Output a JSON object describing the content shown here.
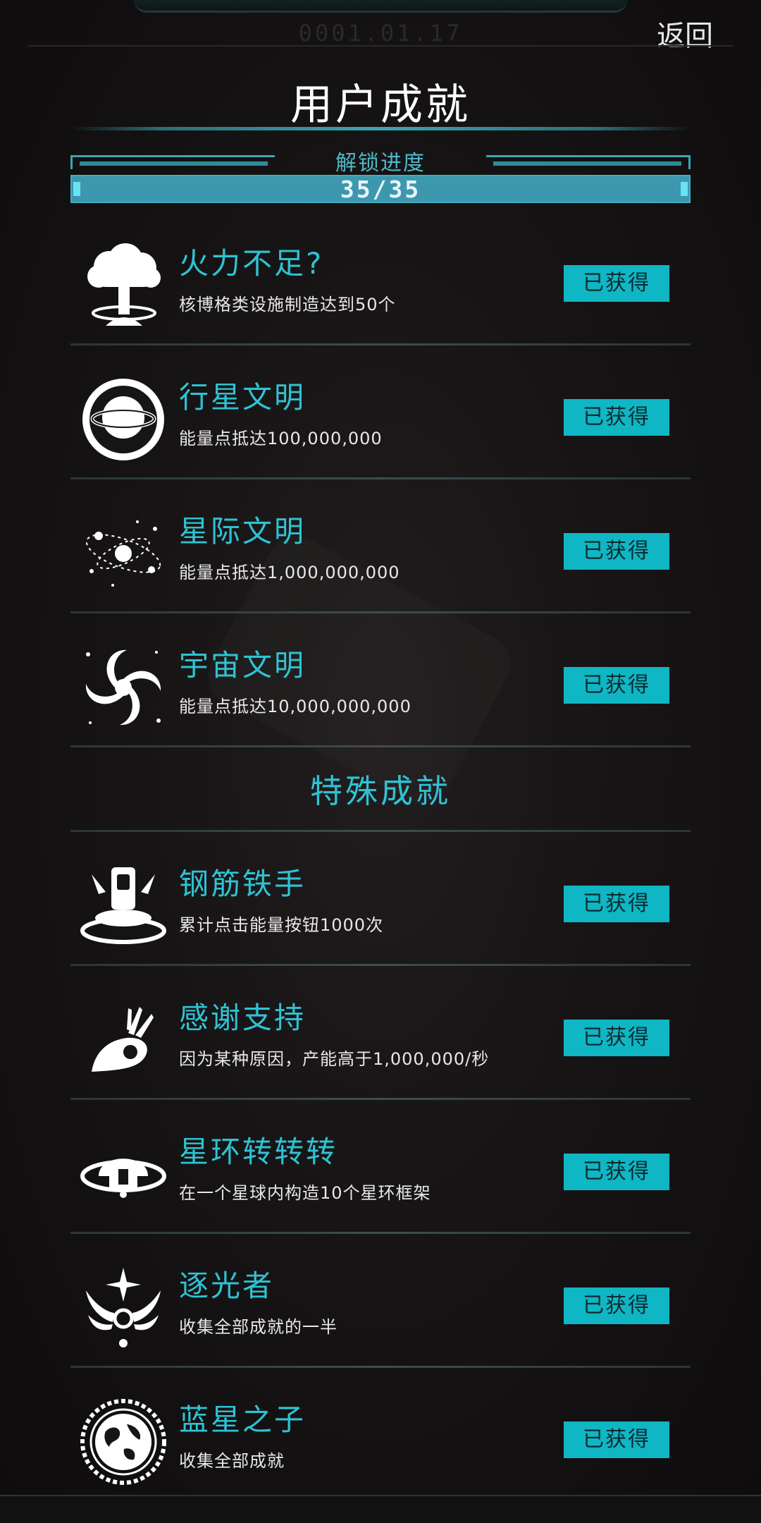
{
  "header": {
    "clock": "0001.01.17",
    "back_label": "返回",
    "title": "用户成就"
  },
  "progress": {
    "label": "解锁进度",
    "value_text": "35/35",
    "fraction": 1.0
  },
  "achievements": [
    {
      "title": "火力不足?",
      "desc": "核博格类设施制造达到50个",
      "badge": "已获得",
      "icon": "nuclear-explosion-icon"
    },
    {
      "title": "行星文明",
      "desc": "能量点抵达100,000,000",
      "badge": "已获得",
      "icon": "planet-icon"
    },
    {
      "title": "星际文明",
      "desc": "能量点抵达1,000,000,000",
      "badge": "已获得",
      "icon": "star-system-icon"
    },
    {
      "title": "宇宙文明",
      "desc": "能量点抵达10,000,000,000",
      "badge": "已获得",
      "icon": "spiral-galaxy-icon"
    }
  ],
  "special_section": {
    "title": "特殊成就",
    "items": [
      {
        "title": "钢筋铁手",
        "desc": "累计点击能量按钮1000次",
        "badge": "已获得",
        "icon": "finger-press-icon"
      },
      {
        "title": "感谢支持",
        "desc": "因为某种原因，产能高于1,000,000/秒",
        "badge": "已获得",
        "icon": "ok-hand-icon"
      },
      {
        "title": "星环转转转",
        "desc": "在一个星球内构造10个星环框架",
        "badge": "已获得",
        "icon": "ring-station-icon"
      },
      {
        "title": "逐光者",
        "desc": "收集全部成就的一半",
        "badge": "已获得",
        "icon": "winged-star-icon"
      },
      {
        "title": "蓝星之子",
        "desc": "收集全部成就",
        "badge": "已获得",
        "icon": "earth-emblem-icon"
      }
    ]
  },
  "colors": {
    "accent": "#2ec3d3",
    "badge_bg": "#0fb6c4",
    "background": "#171415"
  }
}
